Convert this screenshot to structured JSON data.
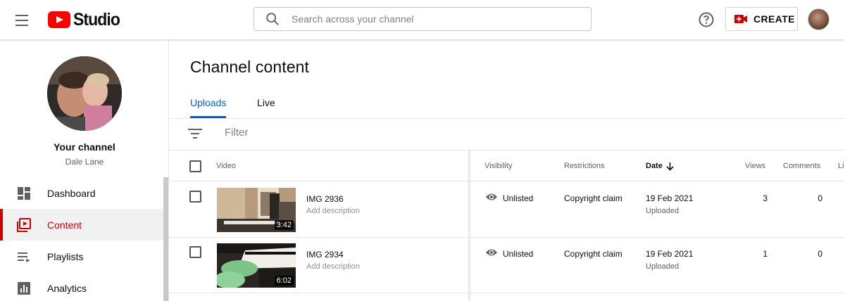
{
  "header": {
    "logo_text": "Studio",
    "search_placeholder": "Search across your channel",
    "create_label": "CREATE"
  },
  "sidebar": {
    "channel_label": "Your channel",
    "channel_user": "Dale Lane",
    "items": [
      {
        "label": "Dashboard",
        "icon": "dashboard-icon",
        "active": false
      },
      {
        "label": "Content",
        "icon": "content-icon",
        "active": true
      },
      {
        "label": "Playlists",
        "icon": "playlists-icon",
        "active": false
      },
      {
        "label": "Analytics",
        "icon": "analytics-icon",
        "active": false
      }
    ]
  },
  "main": {
    "title": "Channel content",
    "tabs": [
      {
        "label": "Uploads",
        "active": true
      },
      {
        "label": "Live",
        "active": false
      }
    ],
    "filter_placeholder": "Filter",
    "columns": {
      "video": "Video",
      "visibility": "Visibility",
      "restrictions": "Restrictions",
      "date": "Date",
      "views": "Views",
      "comments": "Comments",
      "likes": "Li"
    },
    "rows": [
      {
        "title": "IMG 2936",
        "description": "Add description",
        "duration": "3:42",
        "visibility": "Unlisted",
        "restrictions": "Copyright claim",
        "date": "19 Feb 2021",
        "date_status": "Uploaded",
        "views": "3",
        "comments": "0"
      },
      {
        "title": "IMG 2934",
        "description": "Add description",
        "duration": "6:02",
        "visibility": "Unlisted",
        "restrictions": "Copyright claim",
        "date": "19 Feb 2021",
        "date_status": "Uploaded",
        "views": "1",
        "comments": "0"
      }
    ]
  },
  "colors": {
    "brand_red": "#ff0000",
    "active_red": "#cc0000",
    "tab_blue": "#065fd4"
  }
}
